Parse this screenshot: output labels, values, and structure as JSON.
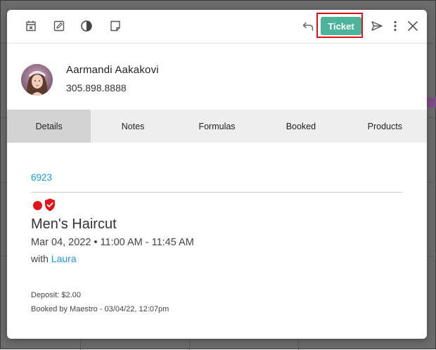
{
  "toolbar": {
    "left_icons": [
      "cancel-calendar-icon",
      "edit-icon",
      "contrast-icon",
      "note-icon"
    ],
    "right_icons": [
      "reply-icon",
      "send-icon",
      "more-vert-icon",
      "close-icon"
    ],
    "ticket_label": "Ticket",
    "ticket_color": "#4db39b",
    "highlight_color": "#d8131b"
  },
  "client": {
    "name": "Aarmandi Aakakovi",
    "phone": "305.898.8888"
  },
  "tabs": [
    {
      "label": "Details",
      "active": true
    },
    {
      "label": "Notes",
      "active": false
    },
    {
      "label": "Formulas",
      "active": false
    },
    {
      "label": "Booked",
      "active": false
    },
    {
      "label": "Products",
      "active": false
    }
  ],
  "appointment": {
    "id": "6923",
    "status_colors": {
      "dot": "#e0141b",
      "shield": "#e0141b"
    },
    "service": "Men's Haircut",
    "date": "Mar 04, 2022",
    "time": "11:00 AM - 11:45 AM",
    "with_prefix": "with",
    "staff": "Laura",
    "deposit": "Deposit: $2.00",
    "booked_by": "Booked by Maestro - 03/04/22, 12:07pm"
  },
  "colors": {
    "link": "#1a9bd7",
    "tab_bar": "#eeeeee",
    "tab_active": "#d3d3d3"
  }
}
